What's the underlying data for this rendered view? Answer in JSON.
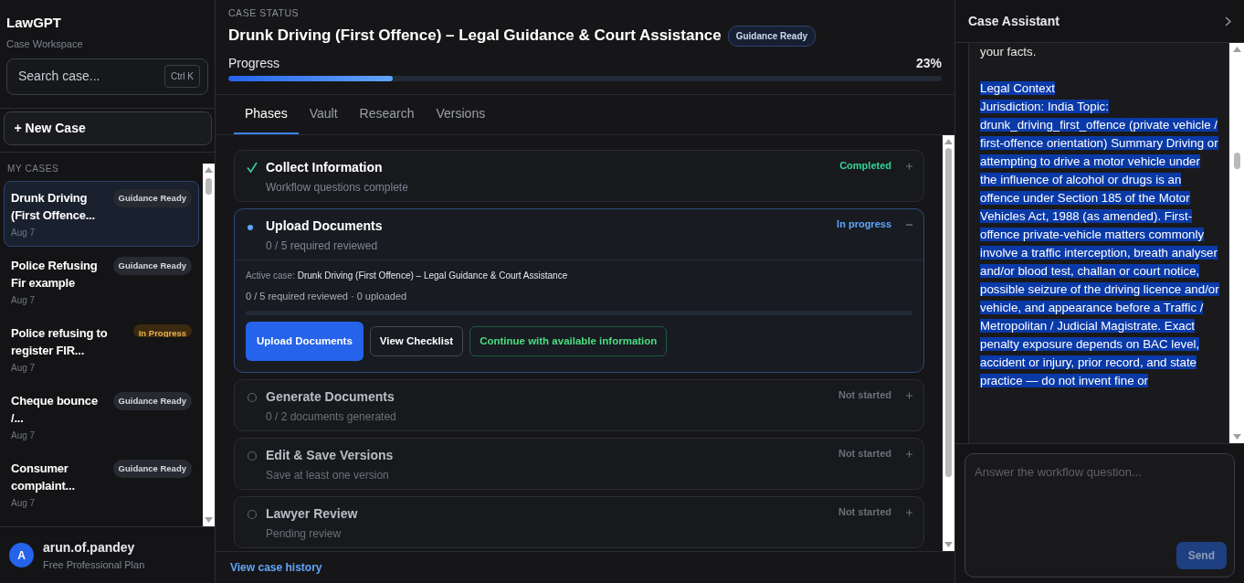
{
  "sidebar": {
    "brand": "LawGPT",
    "subtitle": "Case Workspace",
    "search": {
      "placeholder": "Search case...",
      "shortcut": "Ctrl K"
    },
    "new_case": "+ New Case",
    "section_label": "MY CASES",
    "cases": [
      {
        "title": "Drunk Driving (First Offence...",
        "badge": "Guidance Ready",
        "kind": "ready",
        "date": "Aug 7",
        "selected": true
      },
      {
        "title": "Police Refusing Fir example",
        "badge": "Guidance Ready",
        "kind": "ready",
        "date": "Aug 7",
        "selected": false
      },
      {
        "title": "Police refusing to register FIR...",
        "badge": "In Progress",
        "kind": "progress",
        "date": "Aug 7",
        "selected": false
      },
      {
        "title": "Cheque bounce /...",
        "badge": "Guidance Ready",
        "kind": "ready",
        "date": "Aug 7",
        "selected": false
      },
      {
        "title": "Consumer complaint...",
        "badge": "Guidance Ready",
        "kind": "ready",
        "date": "Aug 7",
        "selected": false
      }
    ],
    "user": {
      "initial": "A",
      "name": "arun.of.pandey",
      "plan": "Free Professional Plan"
    }
  },
  "main": {
    "eyebrow": "CASE STATUS",
    "title": "Drunk Driving (First Offence) – Legal Guidance & Court Assistance",
    "badge": "Guidance Ready",
    "progress": {
      "label": "Progress",
      "reading": "23%",
      "level": 0.23
    },
    "tabs": [
      {
        "label": "Phases",
        "selected": true
      },
      {
        "label": "Vault",
        "selected": false
      },
      {
        "label": "Research",
        "selected": false
      },
      {
        "label": "Versions",
        "selected": false
      }
    ],
    "phases": [
      {
        "title": "Collect Information",
        "subtitle": "Workflow questions complete",
        "status": "Completed",
        "kind": "completed",
        "expanded": false
      },
      {
        "title": "Upload Documents",
        "subtitle": "0 / 5 required reviewed",
        "status": "In progress",
        "kind": "active",
        "expanded": true,
        "details": {
          "active_label": "Active case:",
          "active_case": "Drunk Driving (First Offence) – Legal Guidance & Court Assistance",
          "summary": "0 / 5 required reviewed · 0 uploaded",
          "level": 0,
          "buttons": [
            {
              "label": "Upload Documents",
              "kind": "primary"
            },
            {
              "label": "View Checklist",
              "kind": "outline"
            },
            {
              "label": "Continue with available information",
              "kind": "success"
            }
          ]
        }
      },
      {
        "title": "Generate Documents",
        "subtitle": "0 / 2 documents generated",
        "status": "Not started",
        "kind": "pending",
        "expanded": false
      },
      {
        "title": "Edit & Save Versions",
        "subtitle": "Save at least one version",
        "status": "Not started",
        "kind": "pending",
        "expanded": false
      },
      {
        "title": "Lawyer Review",
        "subtitle": "Pending review",
        "status": "Not started",
        "kind": "pending",
        "expanded": false
      }
    ],
    "history_link": "View case history"
  },
  "assistant": {
    "title": "Case Assistant",
    "message": [
      {
        "text": "your facts.",
        "highlighted": false
      },
      {
        "text": "Legal Context",
        "highlighted": true
      },
      {
        "text": "Jurisdiction: India Topic: drunk_driving_first_offence (private vehicle / first-offence orientation) Summary Driving or attempting to drive a motor vehicle under the influence of alcohol or drugs is an offence under Section 185 of the Motor Vehicles Act, 1988 (as amended). First-offence private-vehicle matters commonly involve a traffic interception, breath analyser and/or blood test, challan or court notice, possible seizure of the driving licence and/or vehicle, and appearance before a Traffic / Metropolitan / Judicial Magistrate. Exact penalty exposure depends on BAC level, accident or injury, prior record, and state practice — do not invent fine or",
        "highlighted": true
      }
    ],
    "input": {
      "placeholder": "Answer the workflow question..."
    },
    "send": "Send"
  }
}
